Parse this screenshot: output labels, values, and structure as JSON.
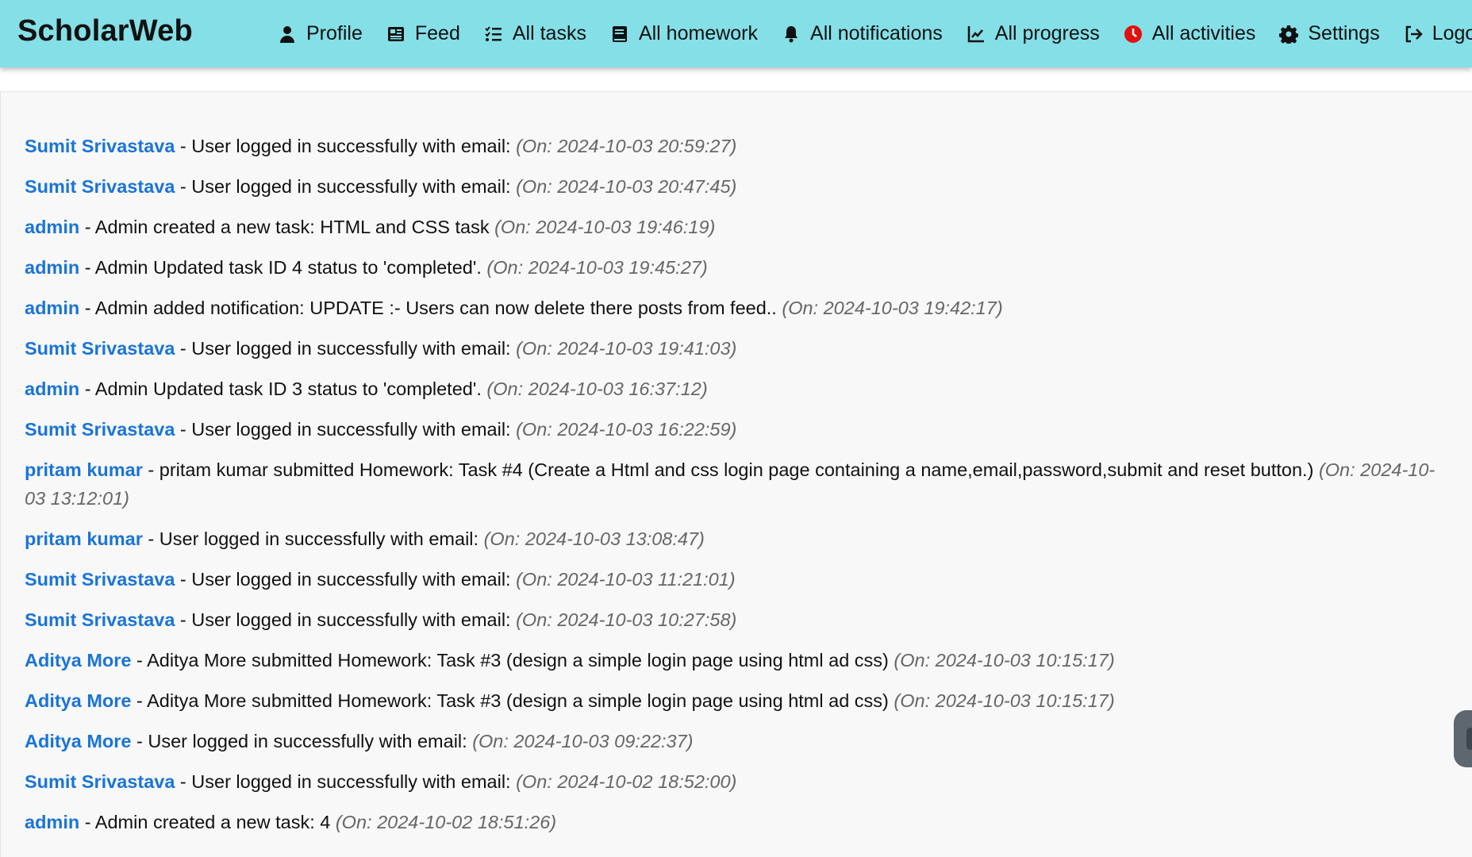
{
  "app": {
    "brand": "ScholarWeb"
  },
  "nav": {
    "items": [
      {
        "label": "Profile",
        "icon": "user-icon"
      },
      {
        "label": "Feed",
        "icon": "newspaper-icon"
      },
      {
        "label": "All tasks",
        "icon": "list-check-icon"
      },
      {
        "label": "All homework",
        "icon": "book-icon"
      },
      {
        "label": "All notifications",
        "icon": "bell-icon"
      },
      {
        "label": "All progress",
        "icon": "chart-line-icon"
      },
      {
        "label": "All activities",
        "icon": "clock-icon"
      },
      {
        "label": "Settings",
        "icon": "gear-icon"
      },
      {
        "label": "Logout",
        "icon": "logout-icon"
      }
    ],
    "activities_icon_color": "#e01010"
  },
  "colors": {
    "navbar_bg": "#85dfe7",
    "user_link": "#1a74d8",
    "timestamp": "#666666"
  },
  "activities": [
    {
      "user": "Sumit Srivastava",
      "message": " - User logged in successfully with email: ",
      "time": "(On: 2024-10-03 20:59:27)"
    },
    {
      "user": "Sumit Srivastava",
      "message": " - User logged in successfully with email: ",
      "time": "(On: 2024-10-03 20:47:45)"
    },
    {
      "user": "admin",
      "message": " - Admin created a new task: HTML and CSS task ",
      "time": "(On: 2024-10-03 19:46:19)"
    },
    {
      "user": "admin",
      "message": " - Admin Updated task ID 4 status to 'completed'. ",
      "time": "(On: 2024-10-03 19:45:27)"
    },
    {
      "user": "admin",
      "message": " - Admin added notification: UPDATE :- Users can now delete there posts from feed.. ",
      "time": "(On: 2024-10-03 19:42:17)"
    },
    {
      "user": "Sumit Srivastava",
      "message": " - User logged in successfully with email: ",
      "time": "(On: 2024-10-03 19:41:03)"
    },
    {
      "user": "admin",
      "message": " - Admin Updated task ID 3 status to 'completed'. ",
      "time": "(On: 2024-10-03 16:37:12)"
    },
    {
      "user": "Sumit Srivastava",
      "message": " - User logged in successfully with email: ",
      "time": "(On: 2024-10-03 16:22:59)"
    },
    {
      "user": "pritam kumar",
      "message": " - pritam kumar submitted Homework: Task #4 (Create a Html and css login page containing a name,email,password,submit and reset button.) ",
      "time": "(On: 2024-10-03 13:12:01)"
    },
    {
      "user": "pritam kumar",
      "message": " - User logged in successfully with email: ",
      "time": "(On: 2024-10-03 13:08:47)"
    },
    {
      "user": "Sumit Srivastava",
      "message": " - User logged in successfully with email: ",
      "time": "(On: 2024-10-03 11:21:01)"
    },
    {
      "user": "Sumit Srivastava",
      "message": " - User logged in successfully with email: ",
      "time": "(On: 2024-10-03 10:27:58)"
    },
    {
      "user": "Aditya More",
      "message": " - Aditya More submitted Homework: Task #3 (design a simple login page using html ad css) ",
      "time": "(On: 2024-10-03 10:15:17)"
    },
    {
      "user": "Aditya More",
      "message": " - Aditya More submitted Homework: Task #3 (design a simple login page using html ad css) ",
      "time": "(On: 2024-10-03 10:15:17)"
    },
    {
      "user": "Aditya More",
      "message": " - User logged in successfully with email: ",
      "time": "(On: 2024-10-03 09:22:37)"
    },
    {
      "user": "Sumit Srivastava",
      "message": " - User logged in successfully with email: ",
      "time": "(On: 2024-10-02 18:52:00)"
    },
    {
      "user": "admin",
      "message": " - Admin created a new task: 4 ",
      "time": "(On: 2024-10-02 18:51:26)"
    }
  ]
}
